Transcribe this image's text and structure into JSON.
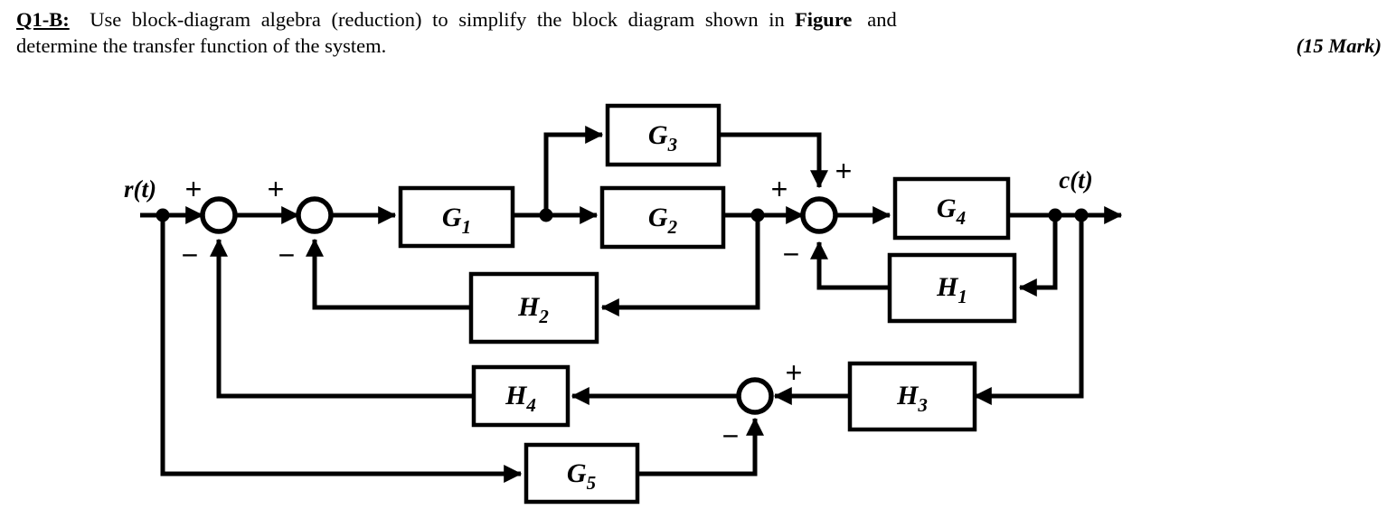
{
  "question": {
    "label": "Q1-B:",
    "line1_a": "Use block-diagram algebra (reduction) to simplify the block diagram shown in",
    "line1_bold": "Figure",
    "line1_b": "and",
    "line2": "determine the transfer function of the system.",
    "marks": "(15 Mark)"
  },
  "diagram": {
    "type": "control-block-diagram",
    "input_signal": "r(t)",
    "output_signal": "c(t)",
    "blocks": [
      {
        "id": "G1",
        "letter": "G",
        "sub": "1"
      },
      {
        "id": "G2",
        "letter": "G",
        "sub": "2"
      },
      {
        "id": "G3",
        "letter": "G",
        "sub": "3"
      },
      {
        "id": "G4",
        "letter": "G",
        "sub": "4"
      },
      {
        "id": "G5",
        "letter": "G",
        "sub": "5"
      },
      {
        "id": "H1",
        "letter": "H",
        "sub": "1"
      },
      {
        "id": "H2",
        "letter": "H",
        "sub": "2"
      },
      {
        "id": "H3",
        "letter": "H",
        "sub": "3"
      },
      {
        "id": "H4",
        "letter": "H",
        "sub": "4"
      }
    ],
    "summing_junctions": [
      {
        "id": "S1",
        "signs": {
          "left": "+",
          "bottom": "−"
        }
      },
      {
        "id": "S2",
        "signs": {
          "left": "+",
          "bottom": "−"
        }
      },
      {
        "id": "S3",
        "signs": {
          "left": "+",
          "top": "+",
          "bottom": "−"
        }
      },
      {
        "id": "S4",
        "signs": {
          "right": "+",
          "bottom": "−"
        }
      }
    ],
    "signs": {
      "s1_plus": "+",
      "s1_minus": "−",
      "s2_plus": "+",
      "s2_minus": "−",
      "s3_plus_left": "+",
      "s3_plus_top": "+",
      "s3_minus": "−",
      "s4_plus": "+",
      "s4_minus": "−"
    },
    "colors": {
      "line": "#000000",
      "block_fill": "#ffffff",
      "background": "#ffffff"
    }
  }
}
